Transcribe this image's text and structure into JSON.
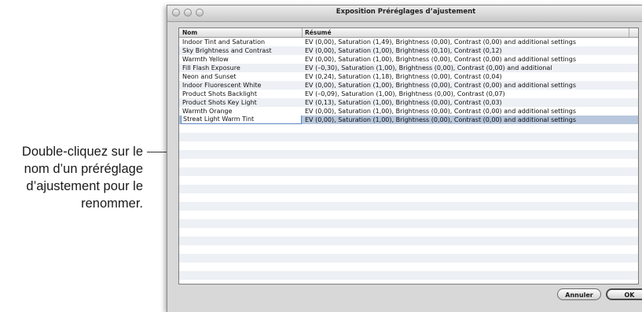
{
  "callout": {
    "lines": [
      "Double-cliquez sur le",
      "nom d’un préréglage",
      "d’ajustement pour le",
      "renommer."
    ]
  },
  "window": {
    "title": "Exposition Préréglages d’ajustement"
  },
  "table": {
    "columns": {
      "name": "Nom",
      "summary": "Résumé"
    },
    "rows": [
      {
        "name": "Indoor Tint and Saturation",
        "summary": "EV (0,00), Saturation (1,49), Brightness (0,00), Contrast (0,00) and additional settings"
      },
      {
        "name": "Sky Brightness and Contrast",
        "summary": "EV (0,00), Saturation (1,00), Brightness (0,10), Contrast (0,12)"
      },
      {
        "name": "Warmth Yellow",
        "summary": "EV (0,00), Saturation (1,00), Brightness (0,00), Contrast (0,00) and additional settings"
      },
      {
        "name": "Fill Flash Exposure",
        "summary": "EV (–0,30), Saturation (1,00), Brightness (0,00), Contrast (0,00) and additional"
      },
      {
        "name": "Neon and Sunset",
        "summary": "EV (0,24), Saturation (1,18), Brightness (0,00), Contrast (0,04)"
      },
      {
        "name": "Indoor Fluorescent White",
        "summary": "EV (0,00), Saturation (1,00), Brightness (0,00), Contrast (0,00) and additional settings"
      },
      {
        "name": "Product Shots Backlight",
        "summary": "EV (–0,09), Saturation (1,00), Brightness (0,00), Contrast (0,07)"
      },
      {
        "name": "Product Shots Key Light",
        "summary": "EV (0,13), Saturation (1,00), Brightness (0,00), Contrast (0,03)"
      },
      {
        "name": "Warmth Orange",
        "summary": "EV (0,00), Saturation (1,00), Brightness (0,00), Contrast (0,00) and additional settings"
      },
      {
        "name": "Streat Light Warm Tint",
        "summary": "EV (0,00), Saturation (1,00), Brightness (0,00), Contrast (0,00) and additional settings",
        "selected": true,
        "editing": true
      }
    ]
  },
  "buttons": {
    "cancel": "Annuler",
    "ok": "OK"
  },
  "colors": {
    "selected_row": "#b9c8dc",
    "alt_row": "#edf0f4",
    "edit_border": "#5d86c0"
  }
}
